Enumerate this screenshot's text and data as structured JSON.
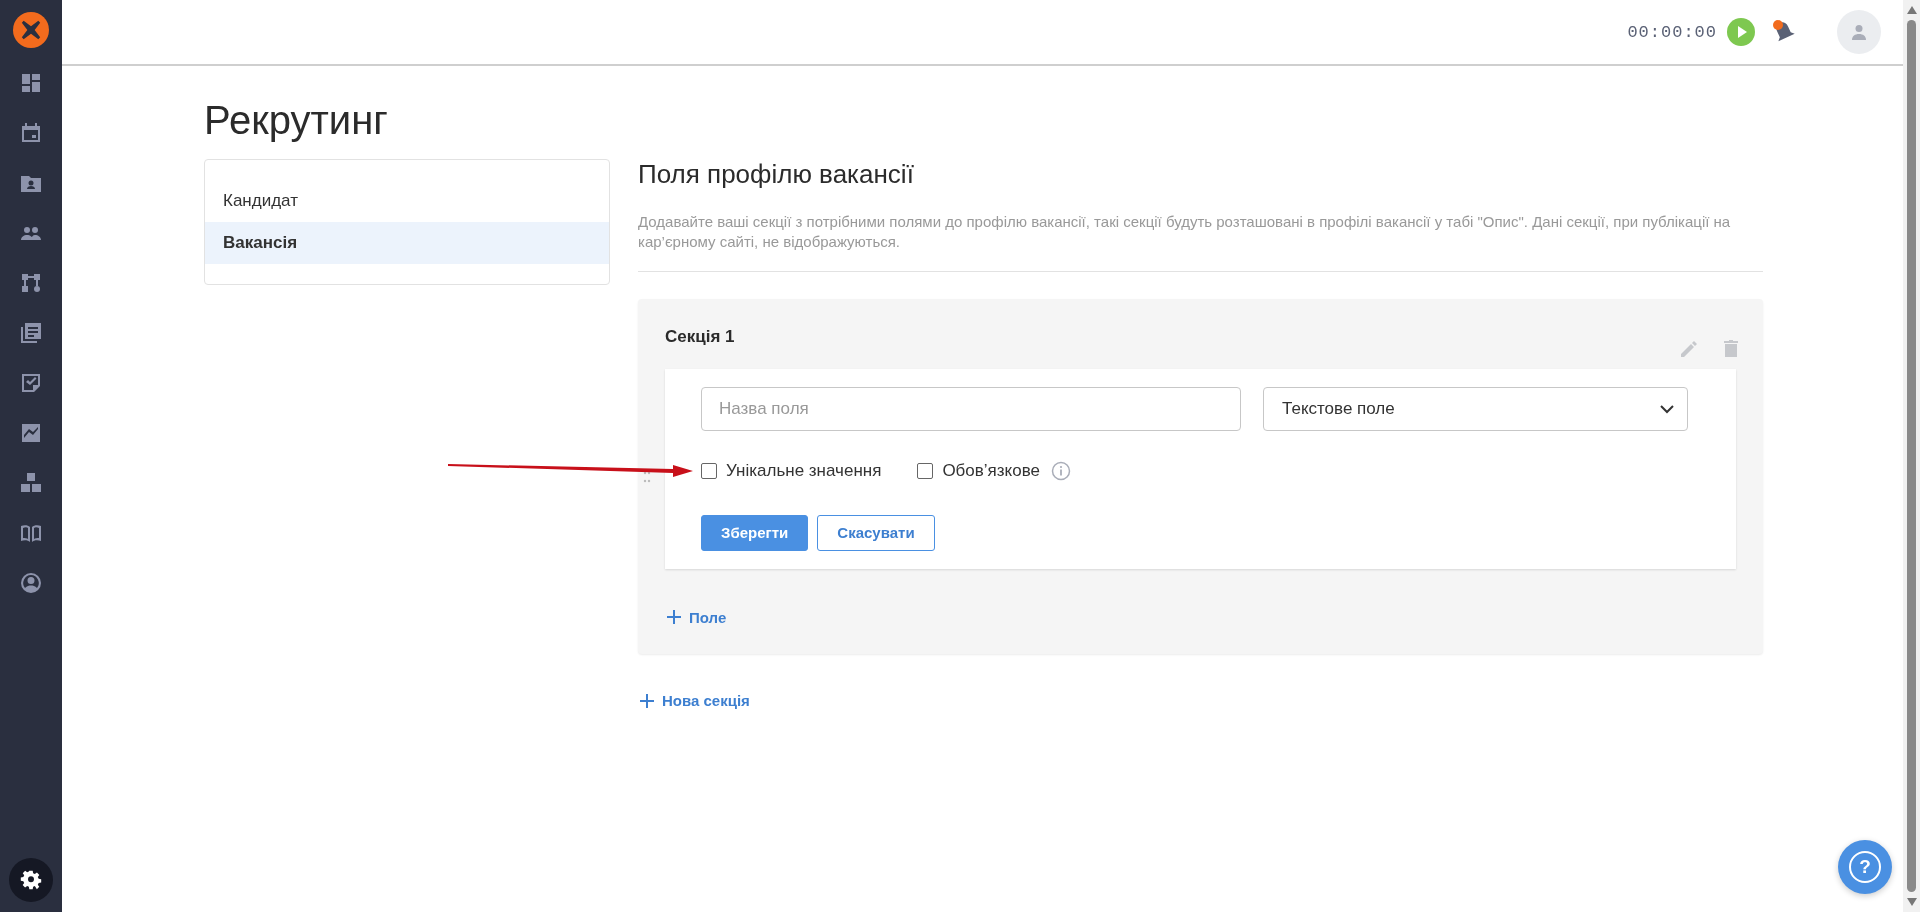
{
  "topbar": {
    "timer": "00:00:00"
  },
  "page": {
    "title": "Рекрутинг"
  },
  "nav": {
    "items": [
      {
        "label": "Кандидат",
        "selected": false
      },
      {
        "label": "Вакансія",
        "selected": true
      }
    ]
  },
  "content": {
    "heading": "Поля профілю вакансії",
    "description": "Додавайте ваші секції з потрібними полями до профілю вакансії, такі секції будуть розташовані в профілі вакансії у табі \"Опис\". Дані секції, при публікації на кар’єрному сайті, не відображуються."
  },
  "sections": [
    {
      "title": "Секція 1",
      "field_form": {
        "name_placeholder": "Назва поля",
        "type_value": "Текстове поле",
        "options": [
          {
            "label": "Унікальне значення",
            "checked": false,
            "info": false
          },
          {
            "label": "Обов’язкове",
            "checked": false,
            "info": true
          }
        ],
        "buttons": [
          {
            "label": "Зберегти",
            "kind": "primary"
          },
          {
            "label": "Скасувати",
            "kind": "secondary"
          }
        ]
      },
      "add_field": "Поле"
    }
  ],
  "add_section": "Нова секція",
  "help": {
    "label": "?"
  }
}
